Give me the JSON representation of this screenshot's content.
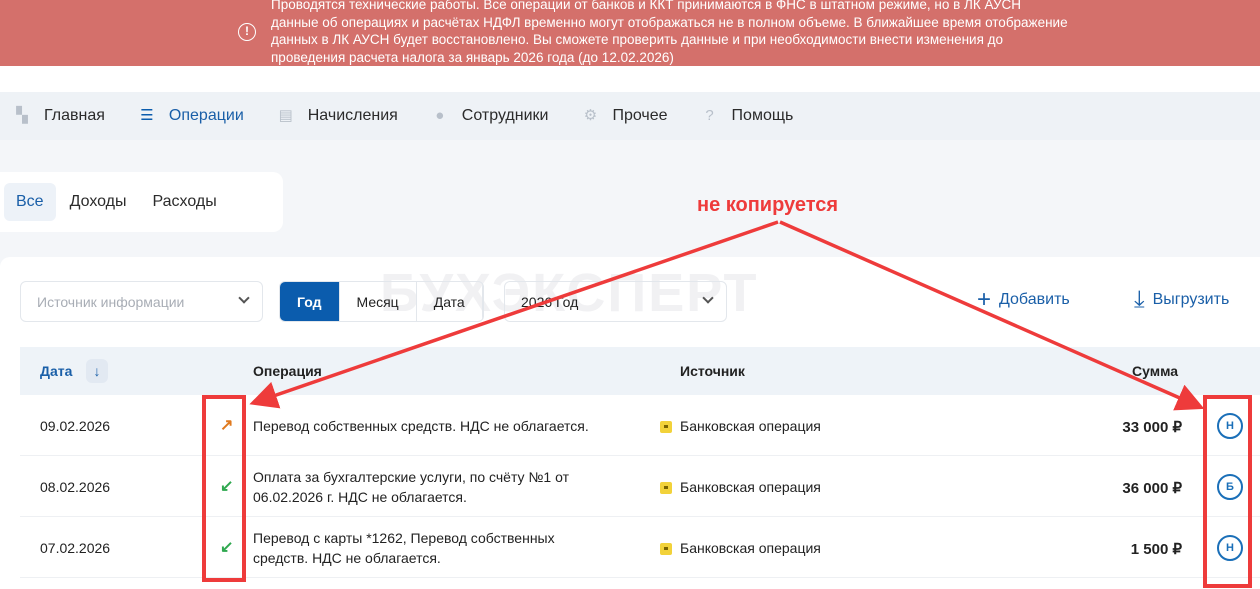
{
  "banner": {
    "icon": "alert-circle-icon",
    "text": "Проводятся технические работы. Все операции от банков и ККТ принимаются в ФНС в штатном режиме, но в ЛК АУСН данные об операциях и расчётах НДФЛ временно могут отображаться не в полном объеме. В ближайшее время отображение данных в ЛК АУСН будет восстановлено. Вы сможете проверить данные и при необходимости внести изменения до проведения расчета налога за январь 2026 года (до 12.02.2026)"
  },
  "nav": [
    {
      "label": "Главная",
      "icon": "grid-icon"
    },
    {
      "label": "Операции",
      "icon": "list-icon"
    },
    {
      "label": "Начисления",
      "icon": "receipt-icon"
    },
    {
      "label": "Сотрудники",
      "icon": "person-icon"
    },
    {
      "label": "Прочее",
      "icon": "gear-icon"
    },
    {
      "label": "Помощь",
      "icon": "help-icon"
    }
  ],
  "tabs": [
    "Все",
    "Доходы",
    "Расходы"
  ],
  "filters": {
    "source_placeholder": "Источник информации",
    "period": [
      "Год",
      "Месяц",
      "Дата"
    ],
    "year": "2026 Год",
    "add": "Добавить",
    "export": "Выгрузить"
  },
  "watermark": "БУХЭКСПЕРТ",
  "table": {
    "headers": {
      "date": "Дата",
      "operation": "Операция",
      "source": "Источник",
      "sum": "Сумма"
    },
    "rows": [
      {
        "date": "09.02.2026",
        "dir": "↗",
        "dir_color": "#e07a1f",
        "op1": "Перевод собственных средств. НДС не облагается.",
        "op2": "",
        "source": "Банковская операция",
        "sum": "33 000 ₽",
        "badge": "Н"
      },
      {
        "date": "08.02.2026",
        "dir": "↙",
        "dir_color": "#2fa84f",
        "op1": "Оплата за бухгалтерские услуги, по счёту №1 от",
        "op2": "06.02.2026 г. НДС не облагается.",
        "source": "Банковская операция",
        "sum": "36 000 ₽",
        "badge": "Б"
      },
      {
        "date": "07.02.2026",
        "dir": "↙",
        "dir_color": "#2fa84f",
        "op1": "Перевод с карты *1262, Перевод собственных",
        "op2": "средств. НДС не облагается.",
        "source": "Банковская операция",
        "sum": "1 500 ₽",
        "badge": "Н"
      }
    ]
  },
  "annotation": "не копируется"
}
